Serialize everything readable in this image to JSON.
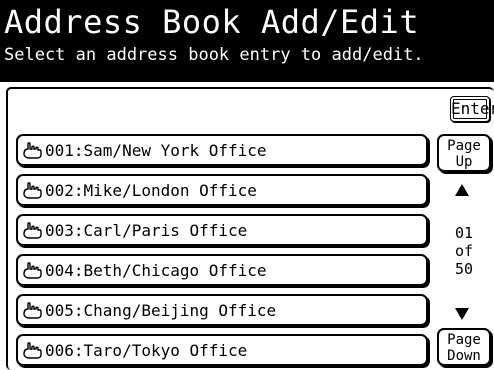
{
  "header": {
    "title": "Address Book Add/Edit",
    "subtitle": "Select an address book entry to add/edit."
  },
  "enter_label": "Enter",
  "entries": [
    {
      "label": "001:Sam/New York Office",
      "icon": "hand-pointer-icon"
    },
    {
      "label": "002:Mike/London Office",
      "icon": "hand-pointer-icon"
    },
    {
      "label": "003:Carl/Paris Office",
      "icon": "hand-pointer-icon"
    },
    {
      "label": "004:Beth/Chicago Office",
      "icon": "hand-pointer-icon"
    },
    {
      "label": "005:Chang/Beijing Office",
      "icon": "hand-pointer-icon"
    },
    {
      "label": "006:Taro/Tokyo Office",
      "icon": "hand-pointer-icon"
    }
  ],
  "pager": {
    "page_up_line1": "Page",
    "page_up_line2": "Up",
    "page_down_line1": "Page",
    "page_down_line2": "Down",
    "current": "01",
    "of": "of",
    "total": "50"
  },
  "colors": {
    "header_bg": "#000000",
    "header_text": "#ffffff",
    "screen_bg": "#ffffff",
    "border": "#000000"
  }
}
